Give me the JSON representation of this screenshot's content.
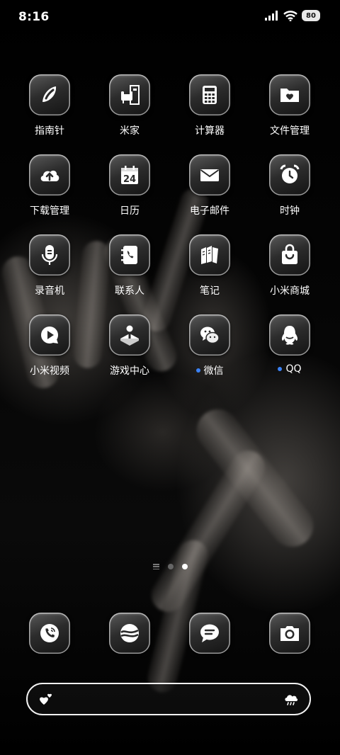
{
  "status_bar": {
    "time": "8:16",
    "battery": "80",
    "icons": [
      "signal-icon",
      "wifi-icon",
      "battery-icon"
    ]
  },
  "apps": [
    {
      "label": "指南针",
      "icon": "compass-icon"
    },
    {
      "label": "米家",
      "icon": "mijia-icon"
    },
    {
      "label": "计算器",
      "icon": "calculator-icon"
    },
    {
      "label": "文件管理",
      "icon": "folder-heart-icon"
    },
    {
      "label": "下载管理",
      "icon": "cloud-upload-icon"
    },
    {
      "label": "日历",
      "icon": "calendar-icon",
      "day": "24"
    },
    {
      "label": "电子邮件",
      "icon": "mail-icon"
    },
    {
      "label": "时钟",
      "icon": "alarm-clock-icon"
    },
    {
      "label": "录音机",
      "icon": "microphone-icon"
    },
    {
      "label": "联系人",
      "icon": "contacts-icon"
    },
    {
      "label": "笔记",
      "icon": "notes-icon"
    },
    {
      "label": "小米商城",
      "icon": "shopping-bag-icon"
    },
    {
      "label": "小米视频",
      "icon": "video-play-icon"
    },
    {
      "label": "游戏中心",
      "icon": "joystick-icon"
    },
    {
      "label": "微信",
      "icon": "wechat-icon",
      "notification": true
    },
    {
      "label": "QQ",
      "icon": "qq-penguin-icon",
      "notification": true
    }
  ],
  "dock": [
    {
      "icon": "phone-icon"
    },
    {
      "icon": "browser-icon"
    },
    {
      "icon": "messages-icon"
    },
    {
      "icon": "camera-icon"
    }
  ],
  "page_indicator": {
    "pages": 2,
    "active": 2
  },
  "search_bar": {
    "left_icon": "hearts-icon",
    "right_icon": "weather-rain-icon"
  },
  "colors": {
    "notification_dot": "#3b82f6",
    "background": "#000000"
  }
}
